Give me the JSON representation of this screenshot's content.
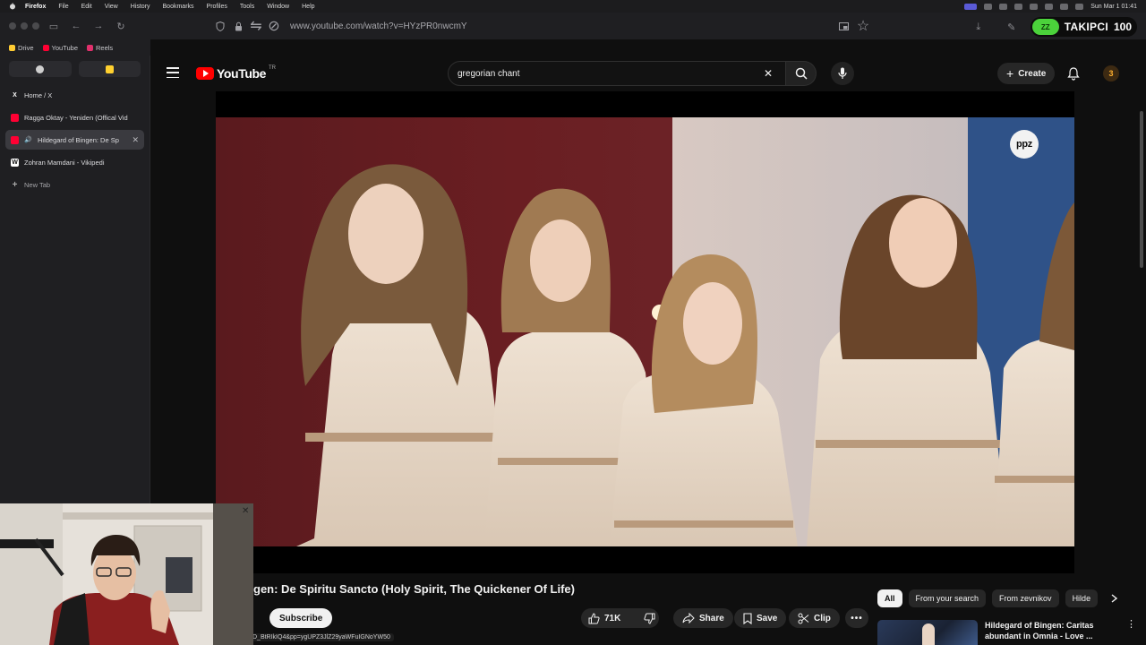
{
  "menubar": {
    "app": "Firefox",
    "items": [
      "File",
      "Edit",
      "View",
      "History",
      "Bookmarks",
      "Profiles",
      "Tools",
      "Window",
      "Help"
    ],
    "clock": "Sun Mar 1  01:41"
  },
  "browser": {
    "url": "www.youtube.com/watch?v=HYzPR0nwcmY",
    "extension": {
      "badge": "ZZ",
      "name": "TAKIPCI",
      "count": "100"
    },
    "bookmarks": [
      {
        "label": "Drive",
        "color": "#ffcc33"
      },
      {
        "label": "YouTube",
        "color": "#ff0033"
      },
      {
        "label": "Reels",
        "color": "#e1306c"
      }
    ],
    "tabs": [
      {
        "label": "Home / X",
        "icon": "x-icon",
        "glyph": "X",
        "color": "#000000"
      },
      {
        "label": "Ragga Oktay - Yeniden (Offical Vid",
        "icon": "youtube-icon",
        "glyph": "",
        "color": "#ff0033"
      },
      {
        "label": "Hildegard of Bingen: De Sp",
        "icon": "youtube-icon",
        "glyph": "",
        "color": "#ff0033",
        "active": true
      },
      {
        "label": "Zohran Mamdani - Vikipedi",
        "icon": "wikipedia-icon",
        "glyph": "W",
        "color": "#ffffff"
      }
    ],
    "new_tab": "New Tab",
    "status_url": "D_BtRIkIQ4&pp=ygUPZ3JlZ29yaWFuIGNoYW50"
  },
  "youtube": {
    "logo_word": "YouTube",
    "logo_country": "TR",
    "search_value": "gregorian chant",
    "create_label": "Create",
    "avatar_letter": "3",
    "watermark": "ppz",
    "video_title": "gen: De Spiritu Sancto (Holy Spirit, The Quickener Of Life)",
    "subscribe_label": "Subscribe",
    "likes": "71K",
    "share_label": "Share",
    "save_label": "Save",
    "clip_label": "Clip",
    "chips": [
      "All",
      "From your search",
      "From zevnikov",
      "Hilde"
    ],
    "rec_title": "Hildegard of Bingen: Caritas abundant in Omnia - Love ..."
  },
  "colors": {
    "youtube_red": "#ff0000",
    "background": "#0f0f0f",
    "extension_green": "#4bd23b"
  }
}
